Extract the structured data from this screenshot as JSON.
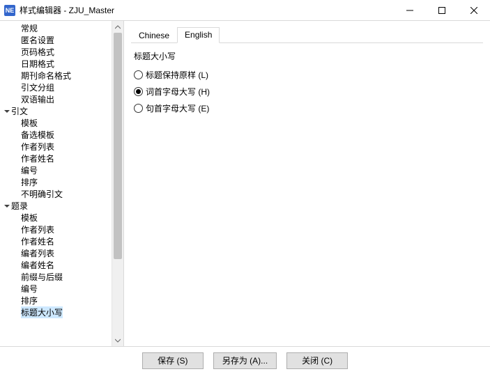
{
  "window": {
    "icon": "NE",
    "title": "样式编辑器 - ZJU_Master"
  },
  "tree": [
    {
      "label": "常规",
      "depth": 1,
      "twisty": ""
    },
    {
      "label": "匿名设置",
      "depth": 1,
      "twisty": ""
    },
    {
      "label": "页码格式",
      "depth": 1,
      "twisty": ""
    },
    {
      "label": "日期格式",
      "depth": 1,
      "twisty": ""
    },
    {
      "label": "期刊命名格式",
      "depth": 1,
      "twisty": ""
    },
    {
      "label": "引文分组",
      "depth": 1,
      "twisty": ""
    },
    {
      "label": "双语输出",
      "depth": 1,
      "twisty": ""
    },
    {
      "label": "引文",
      "depth": 0,
      "twisty": "open"
    },
    {
      "label": "模板",
      "depth": 1,
      "twisty": ""
    },
    {
      "label": "备选模板",
      "depth": 1,
      "twisty": ""
    },
    {
      "label": "作者列表",
      "depth": 1,
      "twisty": ""
    },
    {
      "label": "作者姓名",
      "depth": 1,
      "twisty": ""
    },
    {
      "label": "编号",
      "depth": 1,
      "twisty": ""
    },
    {
      "label": "排序",
      "depth": 1,
      "twisty": ""
    },
    {
      "label": "不明确引文",
      "depth": 1,
      "twisty": ""
    },
    {
      "label": "题录",
      "depth": 0,
      "twisty": "open"
    },
    {
      "label": "模板",
      "depth": 1,
      "twisty": ""
    },
    {
      "label": "作者列表",
      "depth": 1,
      "twisty": ""
    },
    {
      "label": "作者姓名",
      "depth": 1,
      "twisty": ""
    },
    {
      "label": "编者列表",
      "depth": 1,
      "twisty": ""
    },
    {
      "label": "编者姓名",
      "depth": 1,
      "twisty": ""
    },
    {
      "label": "前缀与后缀",
      "depth": 1,
      "twisty": ""
    },
    {
      "label": "编号",
      "depth": 1,
      "twisty": ""
    },
    {
      "label": "排序",
      "depth": 1,
      "twisty": ""
    },
    {
      "label": "标题大小写",
      "depth": 1,
      "twisty": "",
      "selected": true
    }
  ],
  "tabs": {
    "chinese": "Chinese",
    "english": "English",
    "active": "english"
  },
  "panel": {
    "group_title": "标题大小写",
    "options": [
      {
        "label": "标题保持原样 (L)",
        "checked": false
      },
      {
        "label": "词首字母大写 (H)",
        "checked": true
      },
      {
        "label": "句首字母大写 (E)",
        "checked": false
      }
    ]
  },
  "footer": {
    "save": "保存 (S)",
    "saveas": "另存为 (A)...",
    "close": "关闭 (C)"
  }
}
